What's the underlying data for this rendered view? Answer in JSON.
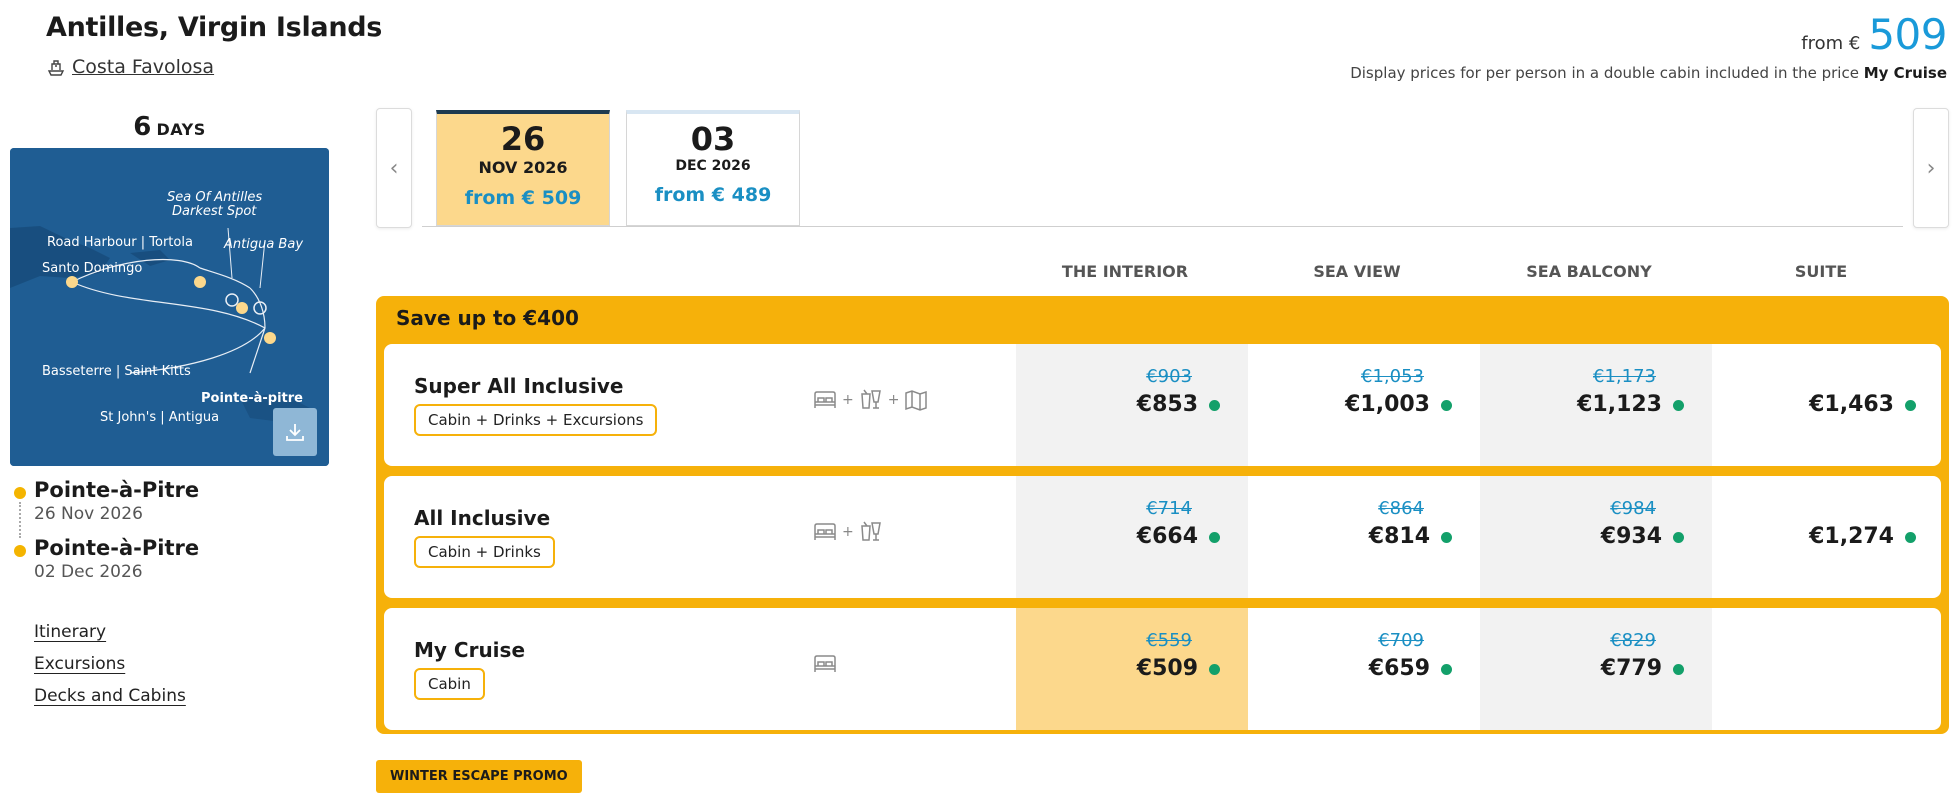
{
  "header": {
    "title": "Antilles, Virgin Islands",
    "ship_name": "Costa Favolosa",
    "from_label": "from €",
    "from_value": "509",
    "note_prefix": "Display prices for per person in a double cabin included in the price",
    "note_bold": "My Cruise"
  },
  "sidebar": {
    "days_num": "6",
    "days_label": "DAYS",
    "map_labels": {
      "sea_antilles_1": "Sea Of Antilles",
      "sea_antilles_2": "Darkest Spot",
      "road_harbour": "Road Harbour | Tortola",
      "antigua_bay": "Antigua Bay",
      "santo_domingo": "Santo Domingo",
      "basseterre": "Basseterre | Saint Kitts",
      "pointe": "Pointe-à-pitre",
      "st_johns": "St John's | Antigua"
    },
    "route": [
      {
        "port": "Pointe-à-Pitre",
        "date": "26 Nov 2026"
      },
      {
        "port": "Pointe-à-Pitre",
        "date": "02 Dec 2026"
      }
    ],
    "links": [
      "Itinerary",
      "Excursions",
      "Decks and Cabins"
    ]
  },
  "dates": {
    "prev": "‹",
    "next": "›",
    "tabs": [
      {
        "day": "26",
        "month": "NOV 2026",
        "from": "from € 509"
      },
      {
        "day": "03",
        "month": "DEC 2026",
        "from": "from € 489"
      }
    ]
  },
  "table": {
    "columns": [
      "THE INTERIOR",
      "SEA VIEW",
      "SEA BALCONY",
      "SUITE"
    ],
    "promo_title": "Save up to €400",
    "rows": [
      {
        "name": "Super All Inclusive",
        "tag": "Cabin + Drinks + Excursions",
        "cells": [
          {
            "old": "€903",
            "new": "€853"
          },
          {
            "old": "€1,053",
            "new": "€1,003"
          },
          {
            "old": "€1,173",
            "new": "€1,123"
          },
          {
            "old": "",
            "new": "€1,463"
          }
        ]
      },
      {
        "name": "All Inclusive",
        "tag": "Cabin + Drinks",
        "cells": [
          {
            "old": "€714",
            "new": "€664"
          },
          {
            "old": "€864",
            "new": "€814"
          },
          {
            "old": "€984",
            "new": "€934"
          },
          {
            "old": "",
            "new": "€1,274"
          }
        ]
      },
      {
        "name": "My Cruise",
        "tag": "Cabin",
        "cells": [
          {
            "old": "€559",
            "new": "€509"
          },
          {
            "old": "€709",
            "new": "€659"
          },
          {
            "old": "€829",
            "new": "€779"
          },
          {
            "old": "",
            "new": ""
          }
        ]
      }
    ],
    "plus": "+"
  },
  "promo_badge": "WINTER ESCAPE PROMO",
  "colors": {
    "accent_yellow": "#f6b10a",
    "highlight": "#fcd88c",
    "price_blue": "#1a9ad9",
    "available_green": "#13a06a"
  }
}
